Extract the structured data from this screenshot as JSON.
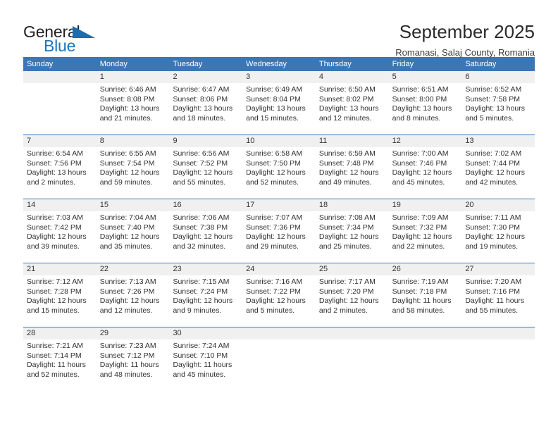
{
  "brand": {
    "name_part1": "General",
    "name_part2": "Blue",
    "triangle_color": "#1b6cb0",
    "blue_color": "#1b75bb"
  },
  "header": {
    "title": "September 2025",
    "subtitle": "Romanasi, Salaj County, Romania"
  },
  "theme": {
    "header_blue": "#3b77b4",
    "daynum_band": "#f0f0f0"
  },
  "weekdays": [
    "Sunday",
    "Monday",
    "Tuesday",
    "Wednesday",
    "Thursday",
    "Friday",
    "Saturday"
  ],
  "weeks": [
    [
      {
        "day": "",
        "lines": []
      },
      {
        "day": "1",
        "lines": [
          "Sunrise: 6:46 AM",
          "Sunset: 8:08 PM",
          "Daylight: 13 hours",
          "and 21 minutes."
        ]
      },
      {
        "day": "2",
        "lines": [
          "Sunrise: 6:47 AM",
          "Sunset: 8:06 PM",
          "Daylight: 13 hours",
          "and 18 minutes."
        ]
      },
      {
        "day": "3",
        "lines": [
          "Sunrise: 6:49 AM",
          "Sunset: 8:04 PM",
          "Daylight: 13 hours",
          "and 15 minutes."
        ]
      },
      {
        "day": "4",
        "lines": [
          "Sunrise: 6:50 AM",
          "Sunset: 8:02 PM",
          "Daylight: 13 hours",
          "and 12 minutes."
        ]
      },
      {
        "day": "5",
        "lines": [
          "Sunrise: 6:51 AM",
          "Sunset: 8:00 PM",
          "Daylight: 13 hours",
          "and 8 minutes."
        ]
      },
      {
        "day": "6",
        "lines": [
          "Sunrise: 6:52 AM",
          "Sunset: 7:58 PM",
          "Daylight: 13 hours",
          "and 5 minutes."
        ]
      }
    ],
    [
      {
        "day": "7",
        "lines": [
          "Sunrise: 6:54 AM",
          "Sunset: 7:56 PM",
          "Daylight: 13 hours",
          "and 2 minutes."
        ]
      },
      {
        "day": "8",
        "lines": [
          "Sunrise: 6:55 AM",
          "Sunset: 7:54 PM",
          "Daylight: 12 hours",
          "and 59 minutes."
        ]
      },
      {
        "day": "9",
        "lines": [
          "Sunrise: 6:56 AM",
          "Sunset: 7:52 PM",
          "Daylight: 12 hours",
          "and 55 minutes."
        ]
      },
      {
        "day": "10",
        "lines": [
          "Sunrise: 6:58 AM",
          "Sunset: 7:50 PM",
          "Daylight: 12 hours",
          "and 52 minutes."
        ]
      },
      {
        "day": "11",
        "lines": [
          "Sunrise: 6:59 AM",
          "Sunset: 7:48 PM",
          "Daylight: 12 hours",
          "and 49 minutes."
        ]
      },
      {
        "day": "12",
        "lines": [
          "Sunrise: 7:00 AM",
          "Sunset: 7:46 PM",
          "Daylight: 12 hours",
          "and 45 minutes."
        ]
      },
      {
        "day": "13",
        "lines": [
          "Sunrise: 7:02 AM",
          "Sunset: 7:44 PM",
          "Daylight: 12 hours",
          "and 42 minutes."
        ]
      }
    ],
    [
      {
        "day": "14",
        "lines": [
          "Sunrise: 7:03 AM",
          "Sunset: 7:42 PM",
          "Daylight: 12 hours",
          "and 39 minutes."
        ]
      },
      {
        "day": "15",
        "lines": [
          "Sunrise: 7:04 AM",
          "Sunset: 7:40 PM",
          "Daylight: 12 hours",
          "and 35 minutes."
        ]
      },
      {
        "day": "16",
        "lines": [
          "Sunrise: 7:06 AM",
          "Sunset: 7:38 PM",
          "Daylight: 12 hours",
          "and 32 minutes."
        ]
      },
      {
        "day": "17",
        "lines": [
          "Sunrise: 7:07 AM",
          "Sunset: 7:36 PM",
          "Daylight: 12 hours",
          "and 29 minutes."
        ]
      },
      {
        "day": "18",
        "lines": [
          "Sunrise: 7:08 AM",
          "Sunset: 7:34 PM",
          "Daylight: 12 hours",
          "and 25 minutes."
        ]
      },
      {
        "day": "19",
        "lines": [
          "Sunrise: 7:09 AM",
          "Sunset: 7:32 PM",
          "Daylight: 12 hours",
          "and 22 minutes."
        ]
      },
      {
        "day": "20",
        "lines": [
          "Sunrise: 7:11 AM",
          "Sunset: 7:30 PM",
          "Daylight: 12 hours",
          "and 19 minutes."
        ]
      }
    ],
    [
      {
        "day": "21",
        "lines": [
          "Sunrise: 7:12 AM",
          "Sunset: 7:28 PM",
          "Daylight: 12 hours",
          "and 15 minutes."
        ]
      },
      {
        "day": "22",
        "lines": [
          "Sunrise: 7:13 AM",
          "Sunset: 7:26 PM",
          "Daylight: 12 hours",
          "and 12 minutes."
        ]
      },
      {
        "day": "23",
        "lines": [
          "Sunrise: 7:15 AM",
          "Sunset: 7:24 PM",
          "Daylight: 12 hours",
          "and 9 minutes."
        ]
      },
      {
        "day": "24",
        "lines": [
          "Sunrise: 7:16 AM",
          "Sunset: 7:22 PM",
          "Daylight: 12 hours",
          "and 5 minutes."
        ]
      },
      {
        "day": "25",
        "lines": [
          "Sunrise: 7:17 AM",
          "Sunset: 7:20 PM",
          "Daylight: 12 hours",
          "and 2 minutes."
        ]
      },
      {
        "day": "26",
        "lines": [
          "Sunrise: 7:19 AM",
          "Sunset: 7:18 PM",
          "Daylight: 11 hours",
          "and 58 minutes."
        ]
      },
      {
        "day": "27",
        "lines": [
          "Sunrise: 7:20 AM",
          "Sunset: 7:16 PM",
          "Daylight: 11 hours",
          "and 55 minutes."
        ]
      }
    ],
    [
      {
        "day": "28",
        "lines": [
          "Sunrise: 7:21 AM",
          "Sunset: 7:14 PM",
          "Daylight: 11 hours",
          "and 52 minutes."
        ]
      },
      {
        "day": "29",
        "lines": [
          "Sunrise: 7:23 AM",
          "Sunset: 7:12 PM",
          "Daylight: 11 hours",
          "and 48 minutes."
        ]
      },
      {
        "day": "30",
        "lines": [
          "Sunrise: 7:24 AM",
          "Sunset: 7:10 PM",
          "Daylight: 11 hours",
          "and 45 minutes."
        ]
      },
      {
        "day": "",
        "lines": []
      },
      {
        "day": "",
        "lines": []
      },
      {
        "day": "",
        "lines": []
      },
      {
        "day": "",
        "lines": []
      }
    ]
  ]
}
